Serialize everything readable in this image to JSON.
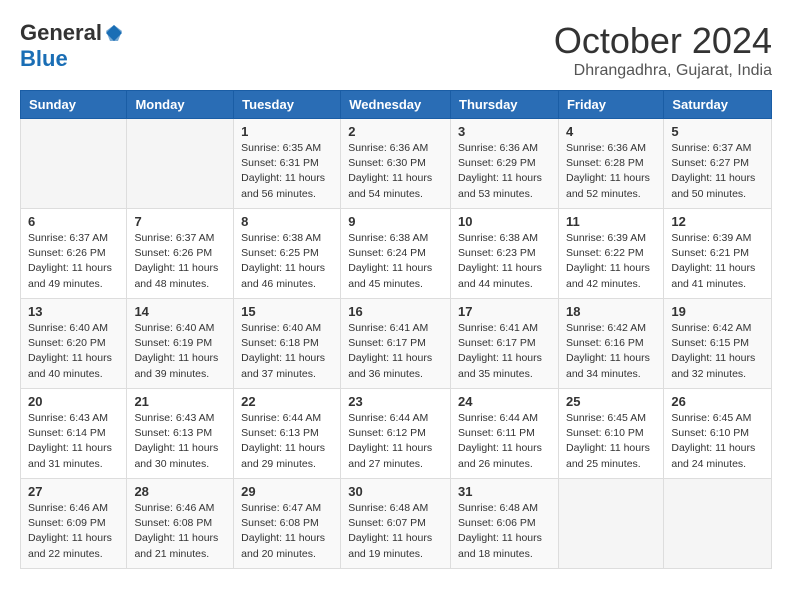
{
  "header": {
    "logo_general": "General",
    "logo_blue": "Blue",
    "month_title": "October 2024",
    "location": "Dhrangadhra, Gujarat, India"
  },
  "days_of_week": [
    "Sunday",
    "Monday",
    "Tuesday",
    "Wednesday",
    "Thursday",
    "Friday",
    "Saturday"
  ],
  "weeks": [
    [
      {
        "day": "",
        "info": ""
      },
      {
        "day": "",
        "info": ""
      },
      {
        "day": "1",
        "info": "Sunrise: 6:35 AM\nSunset: 6:31 PM\nDaylight: 11 hours and 56 minutes."
      },
      {
        "day": "2",
        "info": "Sunrise: 6:36 AM\nSunset: 6:30 PM\nDaylight: 11 hours and 54 minutes."
      },
      {
        "day": "3",
        "info": "Sunrise: 6:36 AM\nSunset: 6:29 PM\nDaylight: 11 hours and 53 minutes."
      },
      {
        "day": "4",
        "info": "Sunrise: 6:36 AM\nSunset: 6:28 PM\nDaylight: 11 hours and 52 minutes."
      },
      {
        "day": "5",
        "info": "Sunrise: 6:37 AM\nSunset: 6:27 PM\nDaylight: 11 hours and 50 minutes."
      }
    ],
    [
      {
        "day": "6",
        "info": "Sunrise: 6:37 AM\nSunset: 6:26 PM\nDaylight: 11 hours and 49 minutes."
      },
      {
        "day": "7",
        "info": "Sunrise: 6:37 AM\nSunset: 6:26 PM\nDaylight: 11 hours and 48 minutes."
      },
      {
        "day": "8",
        "info": "Sunrise: 6:38 AM\nSunset: 6:25 PM\nDaylight: 11 hours and 46 minutes."
      },
      {
        "day": "9",
        "info": "Sunrise: 6:38 AM\nSunset: 6:24 PM\nDaylight: 11 hours and 45 minutes."
      },
      {
        "day": "10",
        "info": "Sunrise: 6:38 AM\nSunset: 6:23 PM\nDaylight: 11 hours and 44 minutes."
      },
      {
        "day": "11",
        "info": "Sunrise: 6:39 AM\nSunset: 6:22 PM\nDaylight: 11 hours and 42 minutes."
      },
      {
        "day": "12",
        "info": "Sunrise: 6:39 AM\nSunset: 6:21 PM\nDaylight: 11 hours and 41 minutes."
      }
    ],
    [
      {
        "day": "13",
        "info": "Sunrise: 6:40 AM\nSunset: 6:20 PM\nDaylight: 11 hours and 40 minutes."
      },
      {
        "day": "14",
        "info": "Sunrise: 6:40 AM\nSunset: 6:19 PM\nDaylight: 11 hours and 39 minutes."
      },
      {
        "day": "15",
        "info": "Sunrise: 6:40 AM\nSunset: 6:18 PM\nDaylight: 11 hours and 37 minutes."
      },
      {
        "day": "16",
        "info": "Sunrise: 6:41 AM\nSunset: 6:17 PM\nDaylight: 11 hours and 36 minutes."
      },
      {
        "day": "17",
        "info": "Sunrise: 6:41 AM\nSunset: 6:17 PM\nDaylight: 11 hours and 35 minutes."
      },
      {
        "day": "18",
        "info": "Sunrise: 6:42 AM\nSunset: 6:16 PM\nDaylight: 11 hours and 34 minutes."
      },
      {
        "day": "19",
        "info": "Sunrise: 6:42 AM\nSunset: 6:15 PM\nDaylight: 11 hours and 32 minutes."
      }
    ],
    [
      {
        "day": "20",
        "info": "Sunrise: 6:43 AM\nSunset: 6:14 PM\nDaylight: 11 hours and 31 minutes."
      },
      {
        "day": "21",
        "info": "Sunrise: 6:43 AM\nSunset: 6:13 PM\nDaylight: 11 hours and 30 minutes."
      },
      {
        "day": "22",
        "info": "Sunrise: 6:44 AM\nSunset: 6:13 PM\nDaylight: 11 hours and 29 minutes."
      },
      {
        "day": "23",
        "info": "Sunrise: 6:44 AM\nSunset: 6:12 PM\nDaylight: 11 hours and 27 minutes."
      },
      {
        "day": "24",
        "info": "Sunrise: 6:44 AM\nSunset: 6:11 PM\nDaylight: 11 hours and 26 minutes."
      },
      {
        "day": "25",
        "info": "Sunrise: 6:45 AM\nSunset: 6:10 PM\nDaylight: 11 hours and 25 minutes."
      },
      {
        "day": "26",
        "info": "Sunrise: 6:45 AM\nSunset: 6:10 PM\nDaylight: 11 hours and 24 minutes."
      }
    ],
    [
      {
        "day": "27",
        "info": "Sunrise: 6:46 AM\nSunset: 6:09 PM\nDaylight: 11 hours and 22 minutes."
      },
      {
        "day": "28",
        "info": "Sunrise: 6:46 AM\nSunset: 6:08 PM\nDaylight: 11 hours and 21 minutes."
      },
      {
        "day": "29",
        "info": "Sunrise: 6:47 AM\nSunset: 6:08 PM\nDaylight: 11 hours and 20 minutes."
      },
      {
        "day": "30",
        "info": "Sunrise: 6:48 AM\nSunset: 6:07 PM\nDaylight: 11 hours and 19 minutes."
      },
      {
        "day": "31",
        "info": "Sunrise: 6:48 AM\nSunset: 6:06 PM\nDaylight: 11 hours and 18 minutes."
      },
      {
        "day": "",
        "info": ""
      },
      {
        "day": "",
        "info": ""
      }
    ]
  ]
}
